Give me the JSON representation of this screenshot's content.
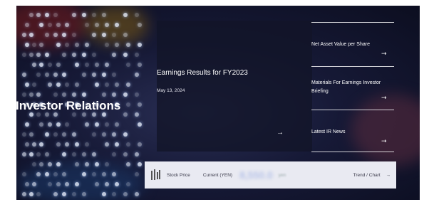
{
  "hero": {
    "title": "Investor Relations"
  },
  "feature_card": {
    "title": "Earnings Results for FY2023",
    "date": "May 13, 2024",
    "arrow": "→"
  },
  "side_links": [
    {
      "label": "Net Asset Value per Share",
      "arrow": "→"
    },
    {
      "label": "Materials For Earnings Investor Briefing",
      "arrow": "→"
    },
    {
      "label": "Latest IR News",
      "arrow": "→"
    }
  ],
  "stock": {
    "label": "Stock Price",
    "current_label": "Current (YEN)",
    "price": "8,550.0",
    "unit": "yen",
    "trend_label": "Trend / Chart",
    "trend_arrow": "→"
  }
}
